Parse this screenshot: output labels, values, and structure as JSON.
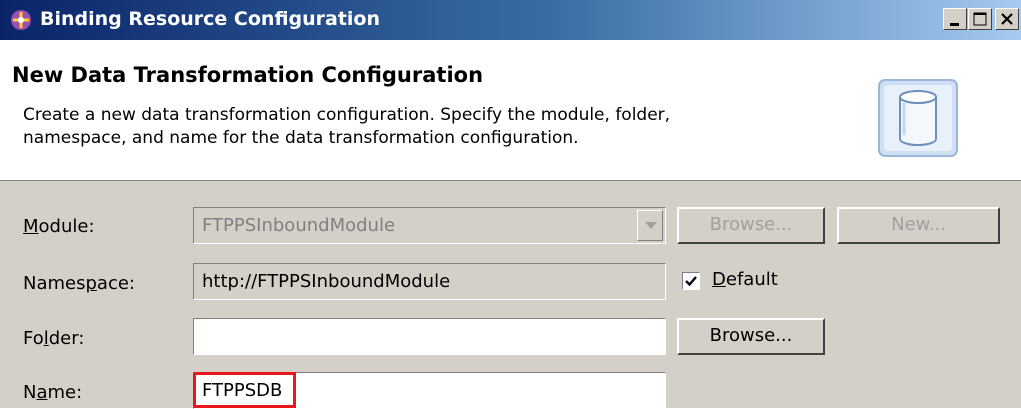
{
  "window": {
    "title": "Binding Resource Configuration",
    "icon": "binding-resource-icon"
  },
  "header": {
    "title": "New Data Transformation Configuration",
    "description_line1": "Create a new data transformation configuration.  Specify the module, folder,",
    "description_line2": "namespace, and name for the data transformation configuration.",
    "image": "database-cylinder-icon"
  },
  "form": {
    "module": {
      "label": "Module:",
      "mnemonic": "M",
      "value": "FTPPSInboundModule",
      "browse_label": "Browse...",
      "new_label": "New..."
    },
    "namespace": {
      "label": "Namespace:",
      "mnemonic": "p",
      "value": "http://FTPPSInboundModule",
      "default_label": "Default",
      "default_checked": true
    },
    "folder": {
      "label": "Folder:",
      "mnemonic": "l",
      "value": "",
      "browse_label": "Browse..."
    },
    "name": {
      "label": "Name:",
      "mnemonic": "a",
      "value": "FTPPSDB"
    }
  },
  "colors": {
    "title_bar_start": "#0a246a",
    "title_bar_end": "#a6caf0",
    "dialog_background": "#d4d0c8",
    "highlight_border": "#e8171b"
  }
}
